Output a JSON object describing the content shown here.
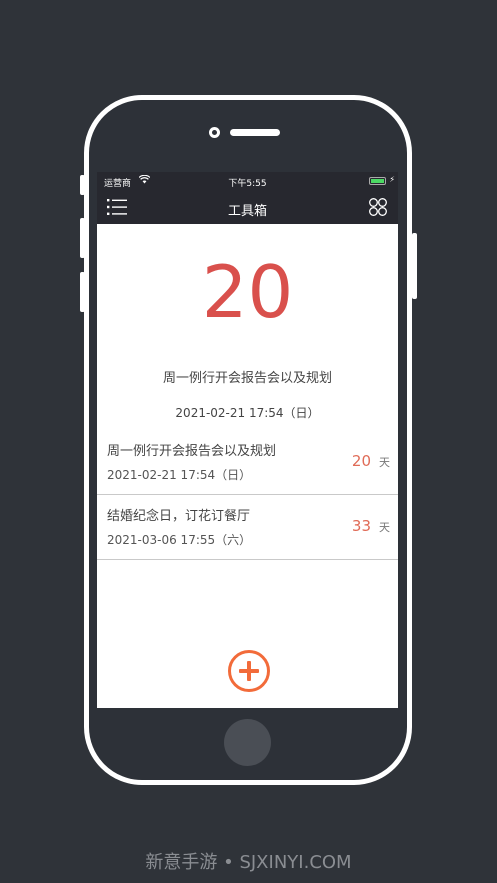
{
  "status_bar": {
    "carrier": "运营商",
    "wifi_icon": "wifi-icon",
    "time": "下午5:55",
    "battery_icon": "battery-icon"
  },
  "nav": {
    "title": "工具箱",
    "menu_icon": "menu-icon",
    "apps_icon": "apps-icon"
  },
  "hero": {
    "days": "20",
    "title": "周一例行开会报告会以及规划",
    "date": "2021-02-21 17:54（日）"
  },
  "events": [
    {
      "title": "周一例行开会报告会以及规划",
      "date": "2021-02-21 17:54（日）",
      "count": "20",
      "unit": "天"
    },
    {
      "title": "结婚纪念日，订花订餐厅",
      "date": "2021-03-06 17:55（六）",
      "count": "33",
      "unit": "天"
    }
  ],
  "add_icon": "plus-circle-icon",
  "watermark": "新意手游 • SJXINYI.COM",
  "colors": {
    "accent_red": "#d9504c",
    "accent_orange": "#f26b3a",
    "navbar": "#27282f"
  }
}
